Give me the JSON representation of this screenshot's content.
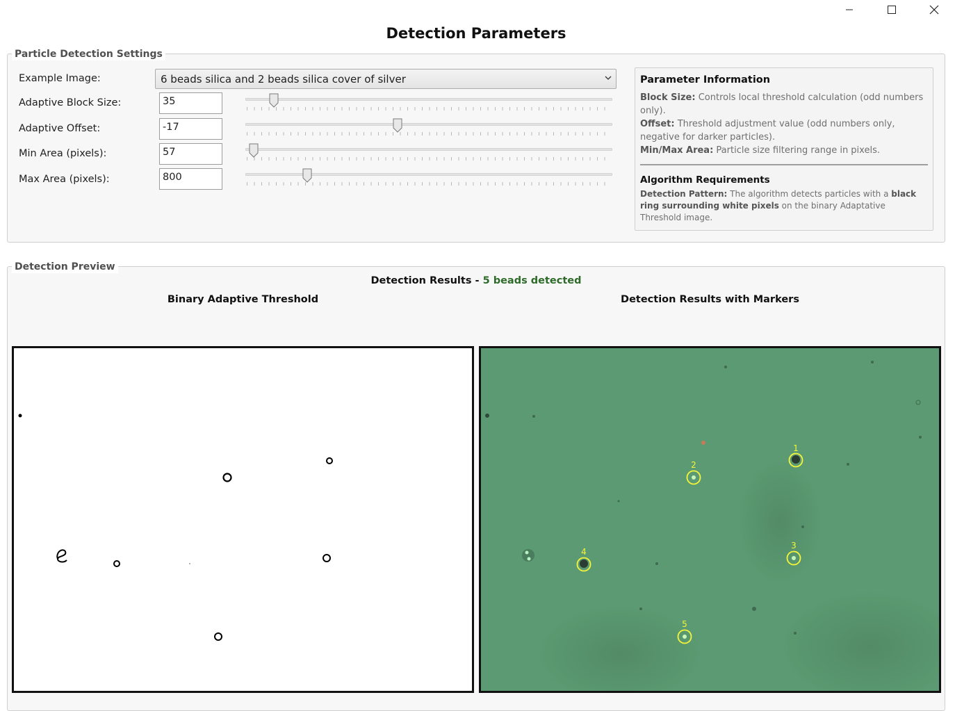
{
  "window": {
    "title": "Detection Parameters",
    "controls": [
      "minimize-icon",
      "maximize-icon",
      "close-icon"
    ]
  },
  "settings": {
    "legend": "Particle Detection Settings",
    "example_image": {
      "label": "Example Image:",
      "selected": "6 beads silica and 2 beads silica cover of silver"
    },
    "params": [
      {
        "label": "Adaptive Block Size:",
        "value": "35",
        "slider_fraction": 0.067
      },
      {
        "label": "Adaptive Offset:",
        "value": "-17",
        "slider_fraction": 0.413
      },
      {
        "label": "Min Area (pixels):",
        "value": "57",
        "slider_fraction": 0.01
      },
      {
        "label": "Max Area (pixels):",
        "value": "800",
        "slider_fraction": 0.16
      }
    ],
    "info": {
      "title": "Parameter Information",
      "block_size_key": "Block Size:",
      "block_size_text": " Controls local threshold calculation (odd numbers only).",
      "offset_key": "Offset:",
      "offset_text": " Threshold adjustment value (odd numbers only, negative for darker particles).",
      "area_key": "Min/Max Area:",
      "area_text": " Particle size filtering range in pixels.",
      "algo_title": "Algorithm Requirements",
      "pattern_key": "Detection Pattern:",
      "pattern_text_1": " The algorithm detects particles with a ",
      "pattern_bold": "black ring surrounding white pixels",
      "pattern_text_2": " on the binary Adaptative Threshold image."
    }
  },
  "preview": {
    "legend": "Detection Preview",
    "results_prefix": "Detection Results - ",
    "results_count": "5 beads detected",
    "left_title": "Binary Adaptive Threshold",
    "right_title": "Detection Results with Markers",
    "markers": [
      "1",
      "2",
      "3",
      "4",
      "5"
    ],
    "colors": {
      "background_green": "#5b9a72",
      "marker_yellow": "#f5f53a",
      "count_green": "#2e6b2a"
    }
  }
}
